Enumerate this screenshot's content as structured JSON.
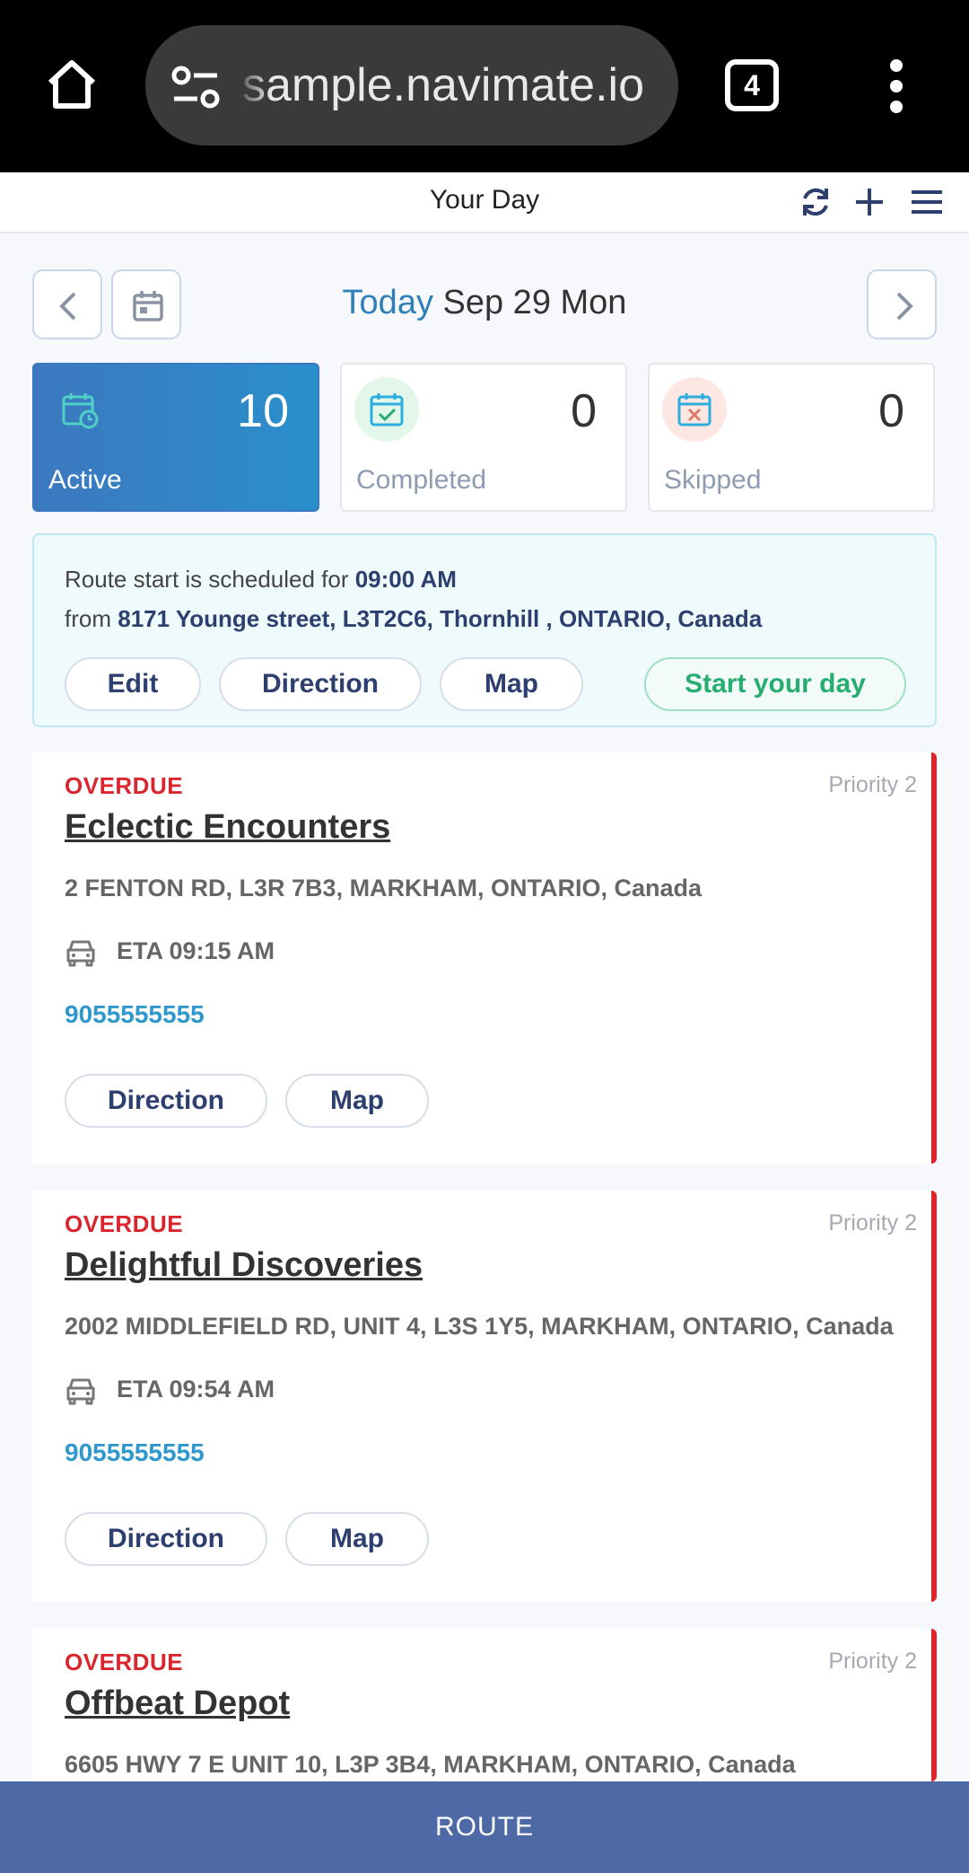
{
  "browser": {
    "url": "sample.navimate.io",
    "tab_count": "4"
  },
  "header": {
    "title": "Your Day"
  },
  "date_nav": {
    "today_label": "Today",
    "date_label": "Sep 29 Mon"
  },
  "stats": [
    {
      "label": "Active",
      "count": "10"
    },
    {
      "label": "Completed",
      "count": "0"
    },
    {
      "label": "Skipped",
      "count": "0"
    }
  ],
  "route_start": {
    "line1_prefix": "Route start is scheduled for ",
    "time": "09:00 AM",
    "line2_prefix": "from ",
    "address": "8171 Younge street, L3T2C6, Thornhill , ONTARIO, Canada",
    "edit_label": "Edit",
    "direction_label": "Direction",
    "map_label": "Map",
    "start_label": "Start your day"
  },
  "jobs": [
    {
      "status": "OVERDUE",
      "priority": "Priority  2",
      "name": "Eclectic Encounters",
      "address": "2 FENTON RD, L3R 7B3, MARKHAM, ONTARIO, Canada",
      "eta": "ETA 09:15 AM",
      "phone": "9055555555",
      "direction_label": "Direction",
      "map_label": "Map"
    },
    {
      "status": "OVERDUE",
      "priority": "Priority  2",
      "name": "Delightful Discoveries",
      "address": "2002 MIDDLEFIELD RD, UNIT 4, L3S 1Y5, MARKHAM, ONTARIO, Canada",
      "eta": "ETA 09:54 AM",
      "phone": "9055555555",
      "direction_label": "Direction",
      "map_label": "Map"
    },
    {
      "status": "OVERDUE",
      "priority": "Priority  2",
      "name": "Offbeat Depot",
      "address": "6605 HWY 7 E UNIT 10, L3P 3B4, MARKHAM, ONTARIO, Canada"
    }
  ],
  "bottom_bar": {
    "label": "ROUTE"
  },
  "colors": {
    "accent": "#2f7fb8",
    "overdue": "#d9262e",
    "success": "#27ad72",
    "route_bar": "#4e6aa6"
  }
}
